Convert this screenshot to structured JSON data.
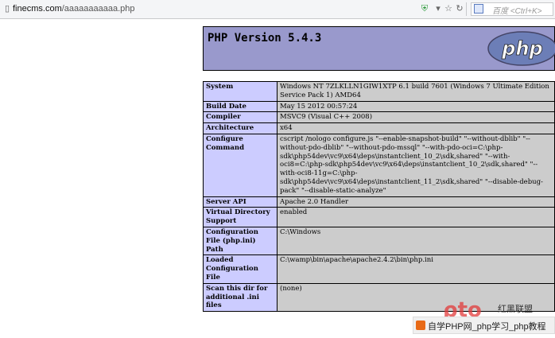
{
  "browser": {
    "url_host": "finecms.com",
    "url_path": "/aaaaaaaaaaa.php",
    "search_engine": "百度",
    "search_hint": "<Ctrl+K>"
  },
  "header": {
    "title": "PHP Version 5.4.3",
    "logo_text": "php"
  },
  "rows": [
    {
      "key": "System",
      "value": "Windows NT 7ZLKLLN1GIW1XTP 6.1 build 7601 (Windows 7 Ultimate Edition Service Pack 1) AMD64"
    },
    {
      "key": "Build Date",
      "value": "May 15 2012 00:57:24"
    },
    {
      "key": "Compiler",
      "value": "MSVC9 (Visual C++ 2008)"
    },
    {
      "key": "Architecture",
      "value": "x64"
    },
    {
      "key": "Configure Command",
      "value": "cscript /nologo configure.js \"--enable-snapshot-build\" \"--without-dblib\" \"--without-pdo-dblib\" \"--without-pdo-mssql\" \"--with-pdo-oci=C:\\php-sdk\\php54dev\\vc9\\x64\\deps\\instantclient_10_2\\sdk,shared\" \"--with-oci8=C:\\php-sdk\\php54dev\\vc9\\x64\\deps\\instantclient_10_2\\sdk,shared\" \"--with-oci8-11g=C:\\php-sdk\\php54dev\\vc9\\x64\\deps\\instantclient_11_2\\sdk,shared\" \"--disable-debug-pack\" \"--disable-static-analyze\""
    },
    {
      "key": "Server API",
      "value": "Apache 2.0 Handler"
    },
    {
      "key": "Virtual Directory Support",
      "value": "enabled"
    },
    {
      "key": "Configuration File (php.ini) Path",
      "value": "C:\\Windows"
    },
    {
      "key": "Loaded Configuration File",
      "value": "C:\\wamp\\bin\\apache\\apache2.4.2\\bin\\php.ini"
    },
    {
      "key": "Scan this dir for additional .ini files",
      "value": "(none)"
    }
  ],
  "watermark": {
    "big": "红黑联盟",
    "badge": "自学PHP网_php学习_php教程"
  },
  "colors": {
    "header_bg": "#9999cc",
    "key_bg": "#ccccff",
    "value_bg": "#cccccc"
  }
}
